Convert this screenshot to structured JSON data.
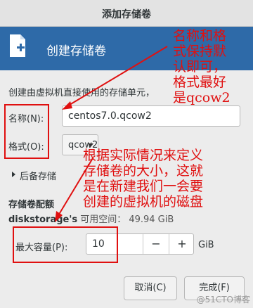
{
  "window": {
    "title": "添加存储卷"
  },
  "banner": {
    "title": "创建存储卷"
  },
  "description": "创建由虚拟机直接使用的存储单元，",
  "form": {
    "name_label": "名称(N):",
    "name_value": "centos7.0.qcow2",
    "format_label": "格式(O):",
    "format_value": "qcow2",
    "backing_label": "后备存储",
    "section_title": "存储卷配额",
    "pool_name": "diskstorage's",
    "pool_available": "可用空间： 49.94 GiB",
    "capacity_label": "最大容量(P):",
    "capacity_value": "10",
    "capacity_unit": "GiB"
  },
  "buttons": {
    "cancel": "取消(C)",
    "finish": "完成(F)"
  },
  "annotations": {
    "note1": [
      "名称和格",
      "式保持默",
      "认即可，",
      "格式最好",
      "是qcow2"
    ],
    "note2": [
      "根据实际情况来定义",
      "存储卷的大小，这就",
      "是在新建我们一会要",
      "创建的虚拟机的磁盘"
    ]
  },
  "watermark": "@51CTO博客",
  "colors": {
    "banner": "#2e6aa8",
    "annotation": "#e01010"
  }
}
